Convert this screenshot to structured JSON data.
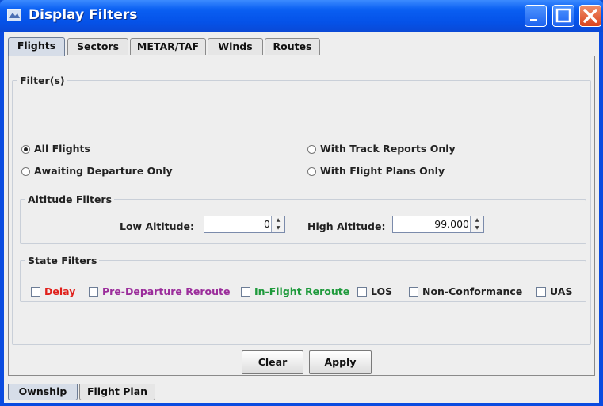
{
  "window": {
    "title": "Display Filters"
  },
  "top_tabs": [
    {
      "label": "Flights",
      "active": true
    },
    {
      "label": "Sectors",
      "active": false
    },
    {
      "label": "METAR/TAF",
      "active": false
    },
    {
      "label": "Winds",
      "active": false
    },
    {
      "label": "Routes",
      "active": false
    }
  ],
  "filters": {
    "legend": "Filter(s)",
    "radios": [
      {
        "label": "All Flights",
        "selected": true
      },
      {
        "label": "Awaiting Departure Only",
        "selected": false
      },
      {
        "label": "With Track Reports Only",
        "selected": false
      },
      {
        "label": "With Flight Plans Only",
        "selected": false
      }
    ]
  },
  "altitude": {
    "legend": "Altitude Filters",
    "low_label": "Low Altitude:",
    "low_value": "0",
    "high_label": "High Altitude:",
    "high_value": "99,000"
  },
  "state": {
    "legend": "State Filters",
    "items": [
      {
        "label": "Delay",
        "color": "#e0201b",
        "checked": false
      },
      {
        "label": "Pre-Departure Reroute",
        "color": "#9b2d9b",
        "checked": false
      },
      {
        "label": "In-Flight Reroute",
        "color": "#1f9a3c",
        "checked": false
      },
      {
        "label": "LOS",
        "color": "#222222",
        "checked": false
      },
      {
        "label": "Non-Conformance",
        "color": "#222222",
        "checked": false
      },
      {
        "label": "UAS",
        "color": "#222222",
        "checked": false
      }
    ]
  },
  "buttons": {
    "clear": "Clear",
    "apply": "Apply"
  },
  "bottom_tabs": [
    {
      "label": "Ownship",
      "active": true
    },
    {
      "label": "Flight Plan",
      "active": false
    }
  ]
}
